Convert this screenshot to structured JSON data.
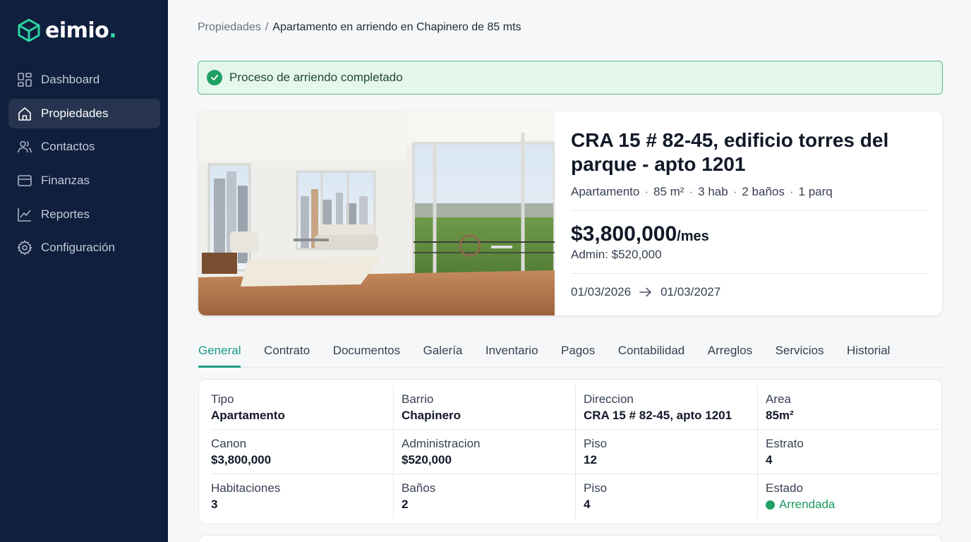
{
  "brand": {
    "name": "eimio",
    "dot": "."
  },
  "sidebar": {
    "items": [
      {
        "label": "Dashboard",
        "icon": "dashboard-icon"
      },
      {
        "label": "Propiedades",
        "icon": "home-icon",
        "active": true
      },
      {
        "label": "Contactos",
        "icon": "users-icon"
      },
      {
        "label": "Finanzas",
        "icon": "credit-card-icon"
      },
      {
        "label": "Reportes",
        "icon": "chart-line-icon"
      },
      {
        "label": "Configuración",
        "icon": "gear-icon"
      }
    ]
  },
  "breadcrumb": {
    "parent": "Propiedades",
    "separator": "/",
    "current": "Apartamento en arriendo en Chapinero de 85 mts"
  },
  "alert": {
    "text": "Proceso de arriendo completado",
    "icon": "check-circle-icon"
  },
  "property": {
    "address": "CRA 15 # 82-45, edificio torres del parque - apto 1201",
    "specs": [
      "Apartamento",
      "85 m²",
      "3 hab",
      "2 baños",
      "1 parq"
    ],
    "spec_separator": "·",
    "price": "$3,800,000",
    "per": "/mes",
    "admin": "Admin: $520,000",
    "start_date": "01/03/2026",
    "end_date": "01/03/2027"
  },
  "tabs": [
    "General",
    "Contrato",
    "Documentos",
    "Galería",
    "Inventario",
    "Pagos",
    "Contabilidad",
    "Arreglos",
    "Servicios",
    "Historial"
  ],
  "details": {
    "rows": [
      [
        {
          "label": "Tipo",
          "value": "Apartamento"
        },
        {
          "label": "Barrio",
          "value": "Chapinero"
        },
        {
          "label": "Direccion",
          "value": "CRA 15 # 82-45, apto 1201"
        },
        {
          "label": "Area",
          "value": "85m²"
        }
      ],
      [
        {
          "label": "Canon",
          "value": "$3,800,000"
        },
        {
          "label": "Administracion",
          "value": "$520,000"
        },
        {
          "label": "Piso",
          "value": "12"
        },
        {
          "label": "Estrato",
          "value": "4"
        }
      ],
      [
        {
          "label": "Habitaciones",
          "value": "3"
        },
        {
          "label": "Baños",
          "value": "2"
        },
        {
          "label": "Piso",
          "value": "4"
        },
        {
          "label": "Estado",
          "value": "Arrendada"
        }
      ]
    ]
  },
  "colors": {
    "sidebar": "#0f1f3d",
    "accent": "#1a9b86",
    "success": "#1fa064",
    "alert_bg": "#e5f6ec"
  }
}
